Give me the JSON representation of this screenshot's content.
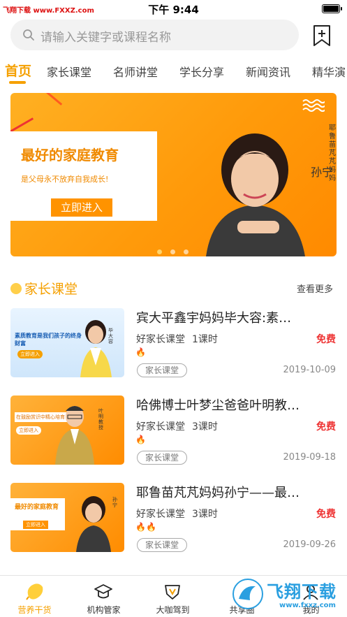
{
  "status_bar": {
    "carrier": "飞翔下载 www.FXXZ.com",
    "time": "下午 9:44"
  },
  "search": {
    "placeholder": "请输入关键字或课程名称"
  },
  "nav": {
    "tabs": [
      "首页",
      "家长课堂",
      "名师讲堂",
      "学长分享",
      "新闻资讯",
      "精华演"
    ],
    "active_index": 0
  },
  "banner": {
    "title": "最好的家庭教育",
    "subtitle": "是父母永不放弃自我成长!",
    "button": "立即进入",
    "name": "孙宁",
    "side_text": "耶鲁苗芃芃妈妈",
    "dot_count": 3,
    "active_dot": 0
  },
  "section": {
    "title": "家长课堂",
    "more": "查看更多"
  },
  "courses": [
    {
      "title": "宾大平鑫宇妈妈毕大容:素…",
      "source": "好家长课堂",
      "hours": "1课时",
      "price": "免费",
      "fire": "🔥",
      "tag": "家长课堂",
      "date": "2019-10-09",
      "thumb_text": "素质教育是我们孩子的终身财富",
      "thumb_name": "毕大容",
      "thumb_button": "立即进入"
    },
    {
      "title": "哈佛博士叶梦尘爸爸叶明教…",
      "source": "好家长课堂",
      "hours": "3课时",
      "price": "免费",
      "fire": "🔥",
      "tag": "家长课堂",
      "date": "2019-09-18",
      "thumb_text": "在鼓励赏识中精心培育",
      "thumb_name": "叶明教授",
      "thumb_button": "立即进入"
    },
    {
      "title": "耶鲁苗芃芃妈妈孙宁——最…",
      "source": "好家长课堂",
      "hours": "3课时",
      "price": "免费",
      "fire": "🔥🔥",
      "tag": "家长课堂",
      "date": "2019-09-26",
      "thumb_text": "最好的家庭教育",
      "thumb_name": "孙宁",
      "thumb_button": "立即进入"
    }
  ],
  "tab_bar": {
    "items": [
      {
        "label": "营养干货",
        "icon": "lemon-icon"
      },
      {
        "label": "机构管家",
        "icon": "graduation-cap-icon"
      },
      {
        "label": "大咖驾到",
        "icon": "v-badge-icon"
      },
      {
        "label": "共享圈",
        "icon": "share-circle-icon"
      },
      {
        "label": "我的",
        "icon": "user-icon"
      }
    ],
    "active_index": 0
  },
  "watermark": {
    "text": "飞翔下载",
    "url": "www.fxxz.com"
  },
  "colors": {
    "accent": "#f5a000",
    "free": "#e33333",
    "banner": "#ff9a0a"
  }
}
